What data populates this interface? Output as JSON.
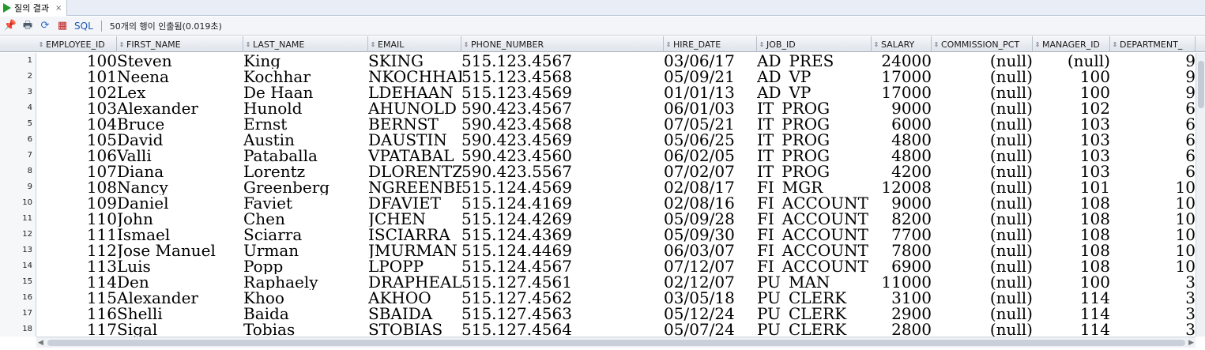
{
  "tab": {
    "label": "질의 결과",
    "close": "×"
  },
  "toolbar": {
    "sql_label": "SQL",
    "status": "50개의 행이 인출됨(0.019초)"
  },
  "columns": [
    "EMPLOYEE_ID",
    "FIRST_NAME",
    "LAST_NAME",
    "EMAIL",
    "PHONE_NUMBER",
    "HIRE_DATE",
    "JOB_ID",
    "SALARY",
    "COMMISSION_PCT",
    "MANAGER_ID",
    "DEPARTMENT_"
  ],
  "rows": [
    [
      "1",
      "100",
      "Steven",
      "King",
      "SKING",
      "515.123.4567",
      "03/06/17",
      "AD_PRES",
      "24000",
      "(null)",
      "(null)",
      "9"
    ],
    [
      "2",
      "101",
      "Neena",
      "Kochhar",
      "NKOCHHAR",
      "515.123.4568",
      "05/09/21",
      "AD_VP",
      "17000",
      "(null)",
      "100",
      "9"
    ],
    [
      "3",
      "102",
      "Lex",
      "De Haan",
      "LDEHAAN",
      "515.123.4569",
      "01/01/13",
      "AD_VP",
      "17000",
      "(null)",
      "100",
      "9"
    ],
    [
      "4",
      "103",
      "Alexander",
      "Hunold",
      "AHUNOLD",
      "590.423.4567",
      "06/01/03",
      "IT_PROG",
      "9000",
      "(null)",
      "102",
      "6"
    ],
    [
      "5",
      "104",
      "Bruce",
      "Ernst",
      "BERNST",
      "590.423.4568",
      "07/05/21",
      "IT_PROG",
      "6000",
      "(null)",
      "103",
      "6"
    ],
    [
      "6",
      "105",
      "David",
      "Austin",
      "DAUSTIN",
      "590.423.4569",
      "05/06/25",
      "IT_PROG",
      "4800",
      "(null)",
      "103",
      "6"
    ],
    [
      "7",
      "106",
      "Valli",
      "Pataballa",
      "VPATABAL",
      "590.423.4560",
      "06/02/05",
      "IT_PROG",
      "4800",
      "(null)",
      "103",
      "6"
    ],
    [
      "8",
      "107",
      "Diana",
      "Lorentz",
      "DLORENTZ",
      "590.423.5567",
      "07/02/07",
      "IT_PROG",
      "4200",
      "(null)",
      "103",
      "6"
    ],
    [
      "9",
      "108",
      "Nancy",
      "Greenberg",
      "NGREENBE",
      "515.124.4569",
      "02/08/17",
      "FI_MGR",
      "12008",
      "(null)",
      "101",
      "10"
    ],
    [
      "10",
      "109",
      "Daniel",
      "Faviet",
      "DFAVIET",
      "515.124.4169",
      "02/08/16",
      "FI_ACCOUNT",
      "9000",
      "(null)",
      "108",
      "10"
    ],
    [
      "11",
      "110",
      "John",
      "Chen",
      "JCHEN",
      "515.124.4269",
      "05/09/28",
      "FI_ACCOUNT",
      "8200",
      "(null)",
      "108",
      "10"
    ],
    [
      "12",
      "111",
      "Ismael",
      "Sciarra",
      "ISCIARRA",
      "515.124.4369",
      "05/09/30",
      "FI_ACCOUNT",
      "7700",
      "(null)",
      "108",
      "10"
    ],
    [
      "13",
      "112",
      "Jose Manuel",
      "Urman",
      "JMURMAN",
      "515.124.4469",
      "06/03/07",
      "FI_ACCOUNT",
      "7800",
      "(null)",
      "108",
      "10"
    ],
    [
      "14",
      "113",
      "Luis",
      "Popp",
      "LPOPP",
      "515.124.4567",
      "07/12/07",
      "FI_ACCOUNT",
      "6900",
      "(null)",
      "108",
      "10"
    ],
    [
      "15",
      "114",
      "Den",
      "Raphaely",
      "DRAPHEAL",
      "515.127.4561",
      "02/12/07",
      "PU_MAN",
      "11000",
      "(null)",
      "100",
      "3"
    ],
    [
      "16",
      "115",
      "Alexander",
      "Khoo",
      "AKHOO",
      "515.127.4562",
      "03/05/18",
      "PU_CLERK",
      "3100",
      "(null)",
      "114",
      "3"
    ],
    [
      "17",
      "116",
      "Shelli",
      "Baida",
      "SBAIDA",
      "515.127.4563",
      "05/12/24",
      "PU_CLERK",
      "2900",
      "(null)",
      "114",
      "3"
    ],
    [
      "18",
      "117",
      "Sigal",
      "Tobias",
      "STOBIAS",
      "515.127.4564",
      "05/07/24",
      "PU_CLERK",
      "2800",
      "(null)",
      "114",
      "3"
    ]
  ]
}
